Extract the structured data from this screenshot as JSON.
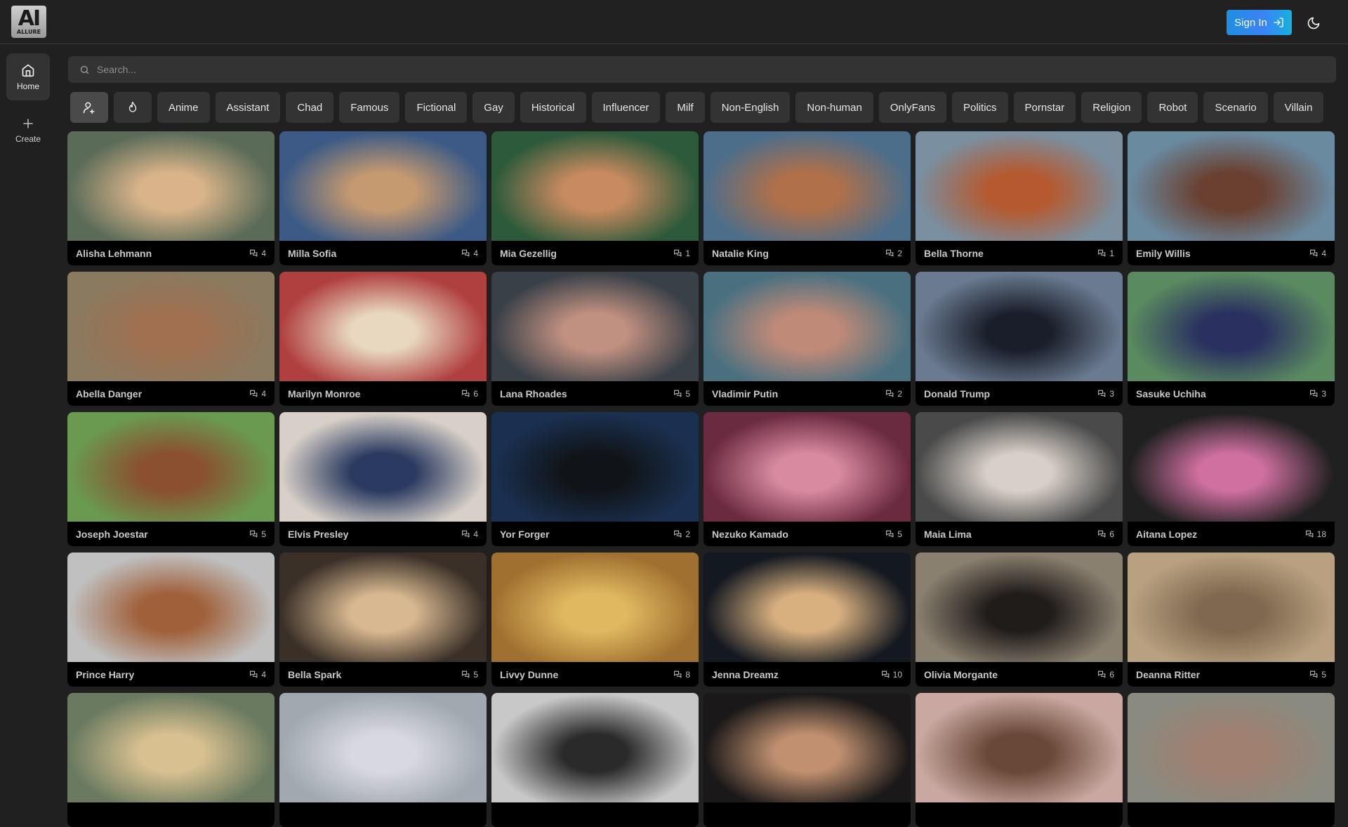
{
  "header": {
    "logo_main": "AI",
    "logo_sub": "ALLURE",
    "signin_label": "Sign In",
    "theme_icon": "moon-icon"
  },
  "sidebar": {
    "items": [
      {
        "label": "Home",
        "icon": "home-icon",
        "active": true
      },
      {
        "label": "Create",
        "icon": "plus-icon",
        "active": false
      }
    ]
  },
  "search": {
    "placeholder": "Search...",
    "value": ""
  },
  "filters": {
    "icon_chips": [
      {
        "icon": "user-plus-icon",
        "selected": true
      },
      {
        "icon": "flame-icon",
        "selected": false
      }
    ],
    "categories": [
      "Anime",
      "Assistant",
      "Chad",
      "Famous",
      "Fictional",
      "Gay",
      "Historical",
      "Influencer",
      "Milf",
      "Non-English",
      "Non-human",
      "OnlyFans",
      "Politics",
      "Pornstar",
      "Religion",
      "Robot",
      "Scenario",
      "Villain"
    ]
  },
  "characters": [
    {
      "name": "Alisha Lehmann",
      "chats": "4",
      "colors": [
        "#5a6b58",
        "#d9b48a"
      ]
    },
    {
      "name": "Milla Sofia",
      "chats": "4",
      "colors": [
        "#3c5a85",
        "#c69a70"
      ]
    },
    {
      "name": "Mia Gezellig",
      "chats": "1",
      "colors": [
        "#2d5a3a",
        "#c88a60"
      ]
    },
    {
      "name": "Natalie King",
      "chats": "2",
      "colors": [
        "#4d6e8a",
        "#b0704a"
      ]
    },
    {
      "name": "Bella Thorne",
      "chats": "1",
      "colors": [
        "#7a8fa0",
        "#b55a30"
      ]
    },
    {
      "name": "Emily Willis",
      "chats": "4",
      "colors": [
        "#6a8aa0",
        "#6a4030"
      ]
    },
    {
      "name": "Abella Danger",
      "chats": "4",
      "colors": [
        "#8a7a60",
        "#a07050"
      ]
    },
    {
      "name": "Marilyn Monroe",
      "chats": "6",
      "colors": [
        "#b04040",
        "#e8d8c0"
      ]
    },
    {
      "name": "Lana Rhoades",
      "chats": "5",
      "colors": [
        "#3a4048",
        "#c09080"
      ]
    },
    {
      "name": "Vladimir Putin",
      "chats": "2",
      "colors": [
        "#4a7080",
        "#c08a78"
      ]
    },
    {
      "name": "Donald Trump",
      "chats": "3",
      "colors": [
        "#6a7a90",
        "#1a1e2a"
      ]
    },
    {
      "name": "Sasuke Uchiha",
      "chats": "3",
      "colors": [
        "#5a8a60",
        "#2a3060"
      ]
    },
    {
      "name": "Joseph Joestar",
      "chats": "5",
      "colors": [
        "#6a9a50",
        "#8a5030"
      ]
    },
    {
      "name": "Elvis Presley",
      "chats": "4",
      "colors": [
        "#d8d0c8",
        "#2a3a60"
      ]
    },
    {
      "name": "Yor Forger",
      "chats": "2",
      "colors": [
        "#1a3050",
        "#101418"
      ]
    },
    {
      "name": "Nezuko Kamado",
      "chats": "5",
      "colors": [
        "#6a2a40",
        "#d88aa0"
      ]
    },
    {
      "name": "Maia Lima",
      "chats": "6",
      "colors": [
        "#4a4a4a",
        "#d8d0c8"
      ]
    },
    {
      "name": "Aitana Lopez",
      "chats": "18",
      "colors": [
        "#202020",
        "#d070a0"
      ]
    },
    {
      "name": "Prince Harry",
      "chats": "4",
      "colors": [
        "#c0c0c0",
        "#a0603a"
      ]
    },
    {
      "name": "Bella Spark",
      "chats": "5",
      "colors": [
        "#3a3028",
        "#d8b890"
      ]
    },
    {
      "name": "Livvy Dunne",
      "chats": "8",
      "colors": [
        "#a07030",
        "#e0b860"
      ]
    },
    {
      "name": "Jenna Dreamz",
      "chats": "10",
      "colors": [
        "#141820",
        "#d8b080"
      ]
    },
    {
      "name": "Olivia Morgante",
      "chats": "6",
      "colors": [
        "#8a8070",
        "#201c1a"
      ]
    },
    {
      "name": "Deanna Ritter",
      "chats": "5",
      "colors": [
        "#b8a080",
        "#806850"
      ]
    },
    {
      "name": "",
      "chats": "",
      "colors": [
        "#6a7a60",
        "#d8c090"
      ]
    },
    {
      "name": "",
      "chats": "",
      "colors": [
        "#a0a8b0",
        "#d8d8e0"
      ]
    },
    {
      "name": "",
      "chats": "",
      "colors": [
        "#c8c8c8",
        "#2a2a2a"
      ]
    },
    {
      "name": "",
      "chats": "",
      "colors": [
        "#1a1818",
        "#c09070"
      ]
    },
    {
      "name": "",
      "chats": "",
      "colors": [
        "#c8a8a0",
        "#6a4838"
      ]
    },
    {
      "name": "",
      "chats": "",
      "colors": [
        "#8a8a80",
        "#a08070"
      ]
    }
  ]
}
